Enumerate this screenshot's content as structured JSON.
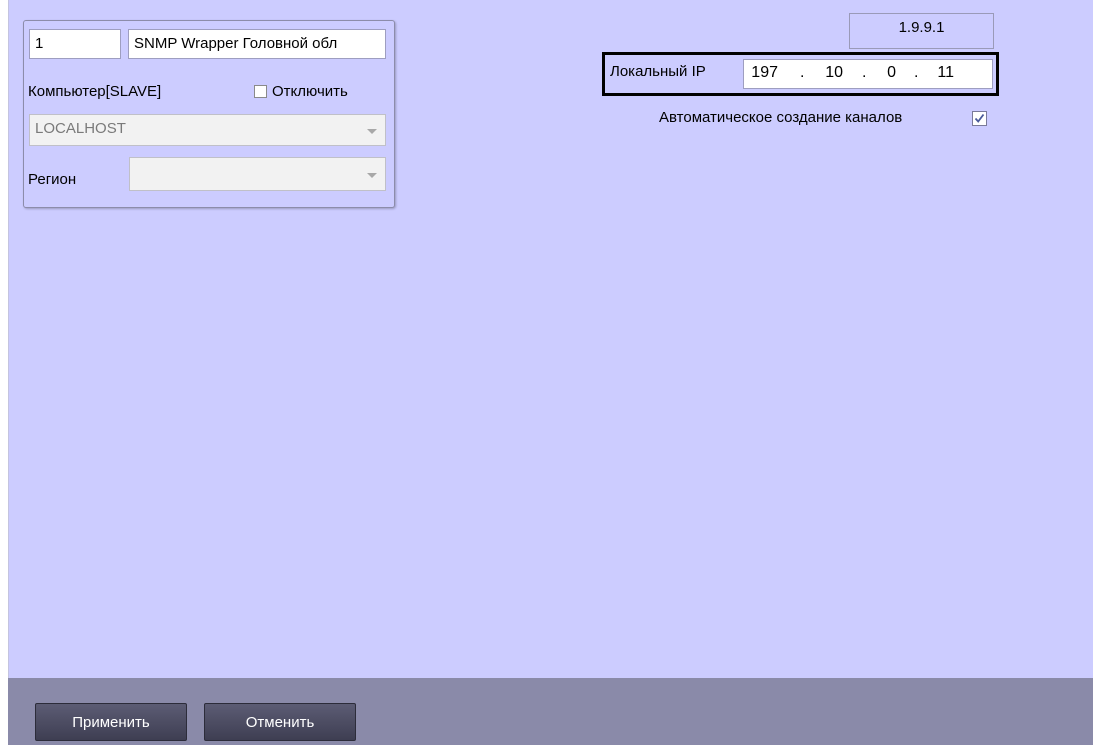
{
  "object": {
    "id": "1",
    "name": "SNMP Wrapper Головной обл",
    "computer_label": "Компьютер[SLAVE]",
    "disable_label": "Отключить",
    "disable_checked": false,
    "computer_value": "LOCALHOST",
    "region_label": "Регион",
    "region_value": ""
  },
  "version": "1.9.9.1",
  "local_ip": {
    "label": "Локальный IP",
    "octets": [
      "197",
      "10",
      "0",
      "11"
    ],
    "separator": "."
  },
  "auto_channels": {
    "label": "Автоматическое создание каналов",
    "checked": true
  },
  "buttons": {
    "apply": "Применить",
    "cancel": "Отменить"
  },
  "colors": {
    "panel_bg": "#ccccff",
    "bottom_bar": "#8a8aa9",
    "button_bg": "#4a4a60",
    "highlight_frame": "#000000"
  }
}
